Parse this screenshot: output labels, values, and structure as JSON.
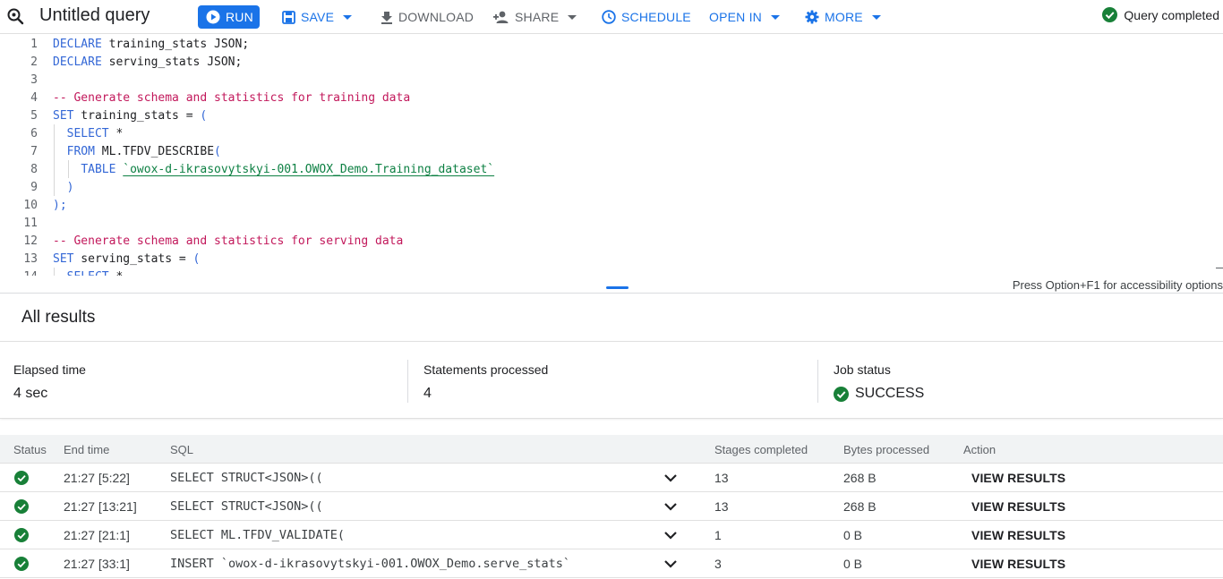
{
  "toolbar": {
    "title": "Untitled query",
    "run_label": "RUN",
    "save_label": "SAVE",
    "download_label": "DOWNLOAD",
    "share_label": "SHARE",
    "schedule_label": "SCHEDULE",
    "open_in_label": "OPEN IN",
    "more_label": "MORE",
    "status_text": "Query completed",
    "status_color": "#188038",
    "accent_color": "#1a73e8"
  },
  "editor": {
    "lines": [
      {
        "n": "1",
        "segments": [
          {
            "t": "DECLARE",
            "c": "kw"
          },
          {
            "t": " training_stats JSON;",
            "c": ""
          }
        ]
      },
      {
        "n": "2",
        "segments": [
          {
            "t": "DECLARE",
            "c": "kw"
          },
          {
            "t": " serving_stats JSON;",
            "c": ""
          }
        ]
      },
      {
        "n": "3",
        "segments": []
      },
      {
        "n": "4",
        "segments": [
          {
            "t": "-- Generate schema and statistics for training data",
            "c": "cm"
          }
        ]
      },
      {
        "n": "5",
        "segments": [
          {
            "t": "SET",
            "c": "kw"
          },
          {
            "t": " training_stats = ",
            "c": ""
          },
          {
            "t": "(",
            "c": "kw"
          }
        ]
      },
      {
        "n": "6",
        "segments": [
          {
            "t": "  ",
            "c": ""
          },
          {
            "t": "SELECT",
            "c": "kw"
          },
          {
            "t": " *",
            "c": ""
          }
        ]
      },
      {
        "n": "7",
        "segments": [
          {
            "t": "  ",
            "c": ""
          },
          {
            "t": "FROM",
            "c": "kw"
          },
          {
            "t": " ML.TFDV_DESCRIBE",
            "c": ""
          },
          {
            "t": "(",
            "c": "kw"
          }
        ]
      },
      {
        "n": "8",
        "segments": [
          {
            "t": "    ",
            "c": ""
          },
          {
            "t": "TABLE",
            "c": "kw"
          },
          {
            "t": " ",
            "c": ""
          },
          {
            "t": "`owox-d-ikrasovytskyi-001.OWOX_Demo.Training_dataset`",
            "c": "str"
          }
        ]
      },
      {
        "n": "9",
        "segments": [
          {
            "t": "  ",
            "c": ""
          },
          {
            "t": ")",
            "c": "kw"
          }
        ]
      },
      {
        "n": "10",
        "segments": [
          {
            "t": ");",
            "c": "kw"
          }
        ]
      },
      {
        "n": "11",
        "segments": []
      },
      {
        "n": "12",
        "segments": [
          {
            "t": "-- Generate schema and statistics for serving data",
            "c": "cm"
          }
        ]
      },
      {
        "n": "13",
        "segments": [
          {
            "t": "SET",
            "c": "kw"
          },
          {
            "t": " serving_stats = ",
            "c": ""
          },
          {
            "t": "(",
            "c": "kw"
          }
        ]
      },
      {
        "n": "14",
        "segments": [
          {
            "t": "  ",
            "c": ""
          },
          {
            "t": "SELECT",
            "c": "kw"
          },
          {
            "t": " *",
            "c": ""
          }
        ]
      }
    ],
    "accessibility_hint": "Press Option+F1 for accessibility options"
  },
  "results": {
    "title": "All results",
    "summary": {
      "elapsed_label": "Elapsed time",
      "elapsed_value": "4 sec",
      "statements_label": "Statements processed",
      "statements_value": "4",
      "job_label": "Job status",
      "job_value": "SUCCESS"
    },
    "columns": [
      "Status",
      "End time",
      "SQL",
      "Stages completed",
      "Bytes processed",
      "Action"
    ],
    "rows": [
      {
        "end_time": "21:27 [5:22]",
        "sql": "SELECT STRUCT<JSON>((",
        "stages": "13",
        "bytes": "268 B",
        "action": "VIEW RESULTS"
      },
      {
        "end_time": "21:27 [13:21]",
        "sql": "SELECT STRUCT<JSON>((",
        "stages": "13",
        "bytes": "268 B",
        "action": "VIEW RESULTS"
      },
      {
        "end_time": "21:27 [21:1]",
        "sql": "SELECT ML.TFDV_VALIDATE(",
        "stages": "1",
        "bytes": "0 B",
        "action": "VIEW RESULTS"
      },
      {
        "end_time": "21:27 [33:1]",
        "sql": "INSERT `owox-d-ikrasovytskyi-001.OWOX_Demo.serve_stats`",
        "stages": "3",
        "bytes": "0 B",
        "action": "VIEW RESULTS"
      }
    ]
  }
}
